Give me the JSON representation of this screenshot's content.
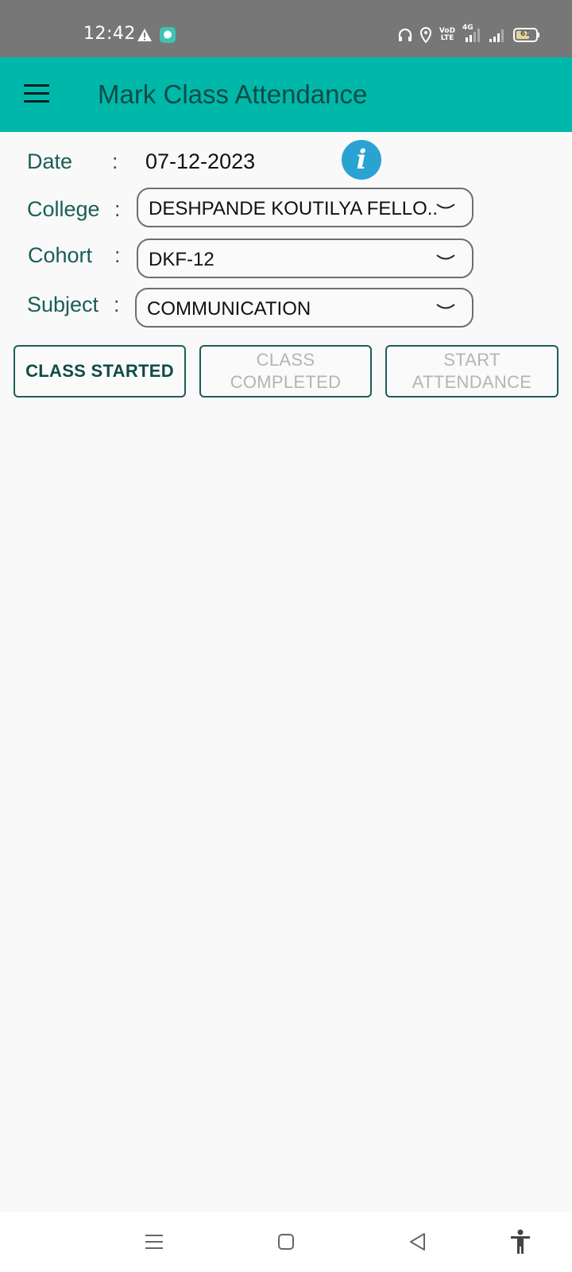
{
  "status_bar": {
    "time": "12:42",
    "net_label": "VoD LTE",
    "net_type": "4G",
    "battery": "61"
  },
  "app_bar": {
    "title": "Mark Class Attendance"
  },
  "form": {
    "date_label": "Date",
    "date_value": "07-12-2023",
    "college_label": "College",
    "college_value": "DESHPANDE KOUTILYA FELLO..",
    "cohort_label": "Cohort",
    "cohort_value": "DKF-12",
    "subject_label": "Subject",
    "subject_value": "COMMUNICATION",
    "colon": ":"
  },
  "buttons": {
    "class_started": "CLASS STARTED",
    "class_completed_line1": "CLASS",
    "class_completed_line2": "COMPLETED",
    "start_attendance_line1": "START",
    "start_attendance_line2": "ATTENDANCE"
  },
  "icons": {
    "info": "info-icon",
    "menu": "hamburger-menu-icon"
  },
  "colors": {
    "app_bar": "#00b8a9",
    "accent_text": "#0f4b47",
    "info": "#2aa3d3"
  }
}
